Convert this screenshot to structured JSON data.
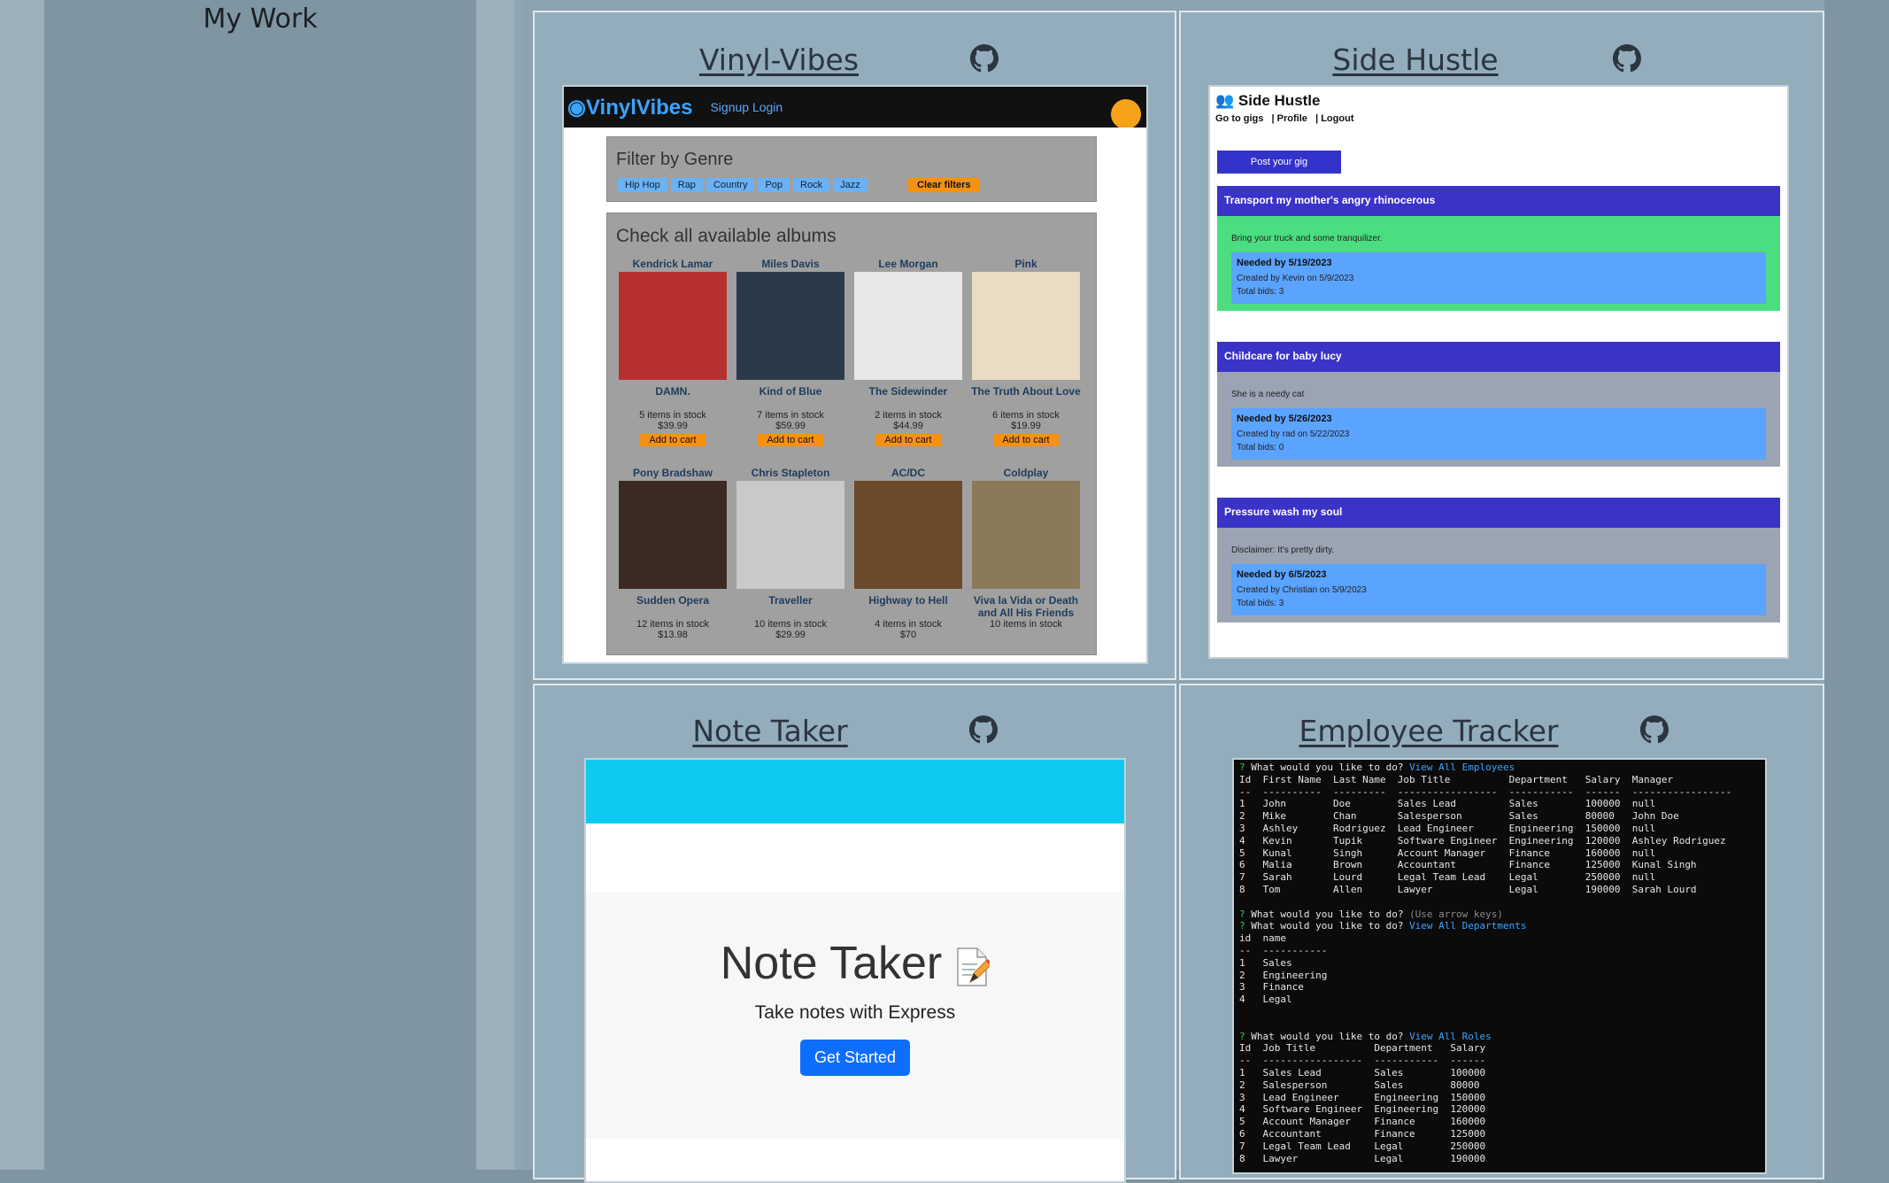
{
  "sidebar": {
    "title": "My Work"
  },
  "projects": [
    {
      "title": "Vinyl-Vibes"
    },
    {
      "title": "Side Hustle"
    },
    {
      "title": "Note Taker"
    },
    {
      "title": "Employee Tracker"
    }
  ],
  "vinyl": {
    "logo": "VinylVibes",
    "nav": "Signup Login",
    "filter_title": "Filter by Genre",
    "genres": [
      "Hip Hop",
      "Rap",
      "Country",
      "Pop",
      "Rock",
      "Jazz"
    ],
    "clear": "Clear filters",
    "albums_title": "Check all available albums",
    "albums": [
      {
        "artist": "Kendrick Lamar",
        "name": "DAMN.",
        "stock": "5 items in stock",
        "price": "$39.99",
        "cart": "Add to cart",
        "color": "#b73030"
      },
      {
        "artist": "Miles Davis",
        "name": "Kind of Blue",
        "stock": "7 items in stock",
        "price": "$59.99",
        "cart": "Add to cart",
        "color": "#2a3a4a"
      },
      {
        "artist": "Lee Morgan",
        "name": "The Sidewinder",
        "stock": "2 items in stock",
        "price": "$44.99",
        "cart": "Add to cart",
        "color": "#e8e8e8"
      },
      {
        "artist": "Pink",
        "name": "The Truth About Love",
        "stock": "6 items in stock",
        "price": "$19.99",
        "cart": "Add to cart",
        "color": "#e9dcc5"
      },
      {
        "artist": "Pony Bradshaw",
        "name": "Sudden Opera",
        "stock": "12 items in stock",
        "price": "$13.98",
        "color": "#3b2a22"
      },
      {
        "artist": "Chris Stapleton",
        "name": "Traveller",
        "stock": "10 items in stock",
        "price": "$29.99",
        "color": "#c9c9c9"
      },
      {
        "artist": "AC/DC",
        "name": "Highway to Hell",
        "stock": "4 items in stock",
        "price": "$70",
        "color": "#6a4a2a"
      },
      {
        "artist": "Coldplay",
        "name": "Viva la Vida or Death and All His Friends",
        "stock": "10 items in stock",
        "price": "",
        "color": "#8a7a5a"
      }
    ]
  },
  "hustle": {
    "title": "Side Hustle",
    "nav": "Go to gigs   | Profile   | Logout",
    "post": "Post your gig",
    "gigs": [
      {
        "title": "Transport my mother's angry rhinocerous",
        "desc": "Bring your truck and some tranquilizer.",
        "needed": "Needed by 5/19/2023",
        "created": "Created by Kevin on 5/9/2023",
        "bids": "Total bids: 3",
        "bg": "#4ade80"
      },
      {
        "title": "Childcare for baby lucy",
        "desc": "She is a needy cat",
        "needed": "Needed by 5/26/2023",
        "created": "Created by rad on 5/22/2023",
        "bids": "Total bids: 0",
        "bg": "#9aa4b3"
      },
      {
        "title": "Pressure wash my soul",
        "desc": "Disclaimer: It's pretty dirty.",
        "needed": "Needed by 6/5/2023",
        "created": "Created by Christian on 5/9/2023",
        "bids": "Total bids: 3",
        "bg": "#9aa4b3"
      }
    ]
  },
  "note": {
    "heading": "Note Taker",
    "sub": "Take notes with Express",
    "button": "Get Started"
  },
  "terminal": {
    "lines": [
      [
        "q",
        "? ",
        "What would you like to do? ",
        "a",
        "View All Employees"
      ],
      [
        "",
        "Id  First Name  Last Name  Job Title          Department   Salary  Manager"
      ],
      [
        "",
        "--  ----------  ---------  -----------------  -----------  ------  -----------------"
      ],
      [
        "",
        "1   John        Doe        Sales Lead         Sales        100000  null"
      ],
      [
        "",
        "2   Mike        Chan       Salesperson        Sales        80000   John Doe"
      ],
      [
        "",
        "3   Ashley      Rodriguez  Lead Engineer      Engineering  150000  null"
      ],
      [
        "",
        "4   Kevin       Tupik      Software Engineer  Engineering  120000  Ashley Rodriguez"
      ],
      [
        "",
        "5   Kunal       Singh      Account Manager    Finance      160000  null"
      ],
      [
        "",
        "6   Malia       Brown      Accountant         Finance      125000  Kunal Singh"
      ],
      [
        "",
        "7   Sarah       Lourd      Legal Team Lead    Legal        250000  null"
      ],
      [
        "",
        "8   Tom         Allen      Lawyer             Legal        190000  Sarah Lourd"
      ],
      [
        "",
        ""
      ],
      [
        "q",
        "? ",
        "What would you like to do? ",
        "g",
        "(Use arrow keys)"
      ],
      [
        "q",
        "? ",
        "What would you like to do? ",
        "a",
        "View All Departments"
      ],
      [
        "",
        "id  name"
      ],
      [
        "",
        "--  -----------"
      ],
      [
        "",
        "1   Sales"
      ],
      [
        "",
        "2   Engineering"
      ],
      [
        "",
        "3   Finance"
      ],
      [
        "",
        "4   Legal"
      ],
      [
        "",
        ""
      ],
      [
        "",
        ""
      ],
      [
        "q",
        "? ",
        "What would you like to do? ",
        "a",
        "View All Roles"
      ],
      [
        "",
        "Id  Job Title          Department   Salary"
      ],
      [
        "",
        "--  -----------------  -----------  ------"
      ],
      [
        "",
        "1   Sales Lead         Sales        100000"
      ],
      [
        "",
        "2   Salesperson        Sales        80000"
      ],
      [
        "",
        "3   Lead Engineer      Engineering  150000"
      ],
      [
        "",
        "4   Software Engineer  Engineering  120000"
      ],
      [
        "",
        "5   Account Manager    Finance      160000"
      ],
      [
        "",
        "6   Accountant         Finance      125000"
      ],
      [
        "",
        "7   Legal Team Lead    Legal        250000"
      ],
      [
        "",
        "8   Lawyer             Legal        190000"
      ]
    ]
  }
}
